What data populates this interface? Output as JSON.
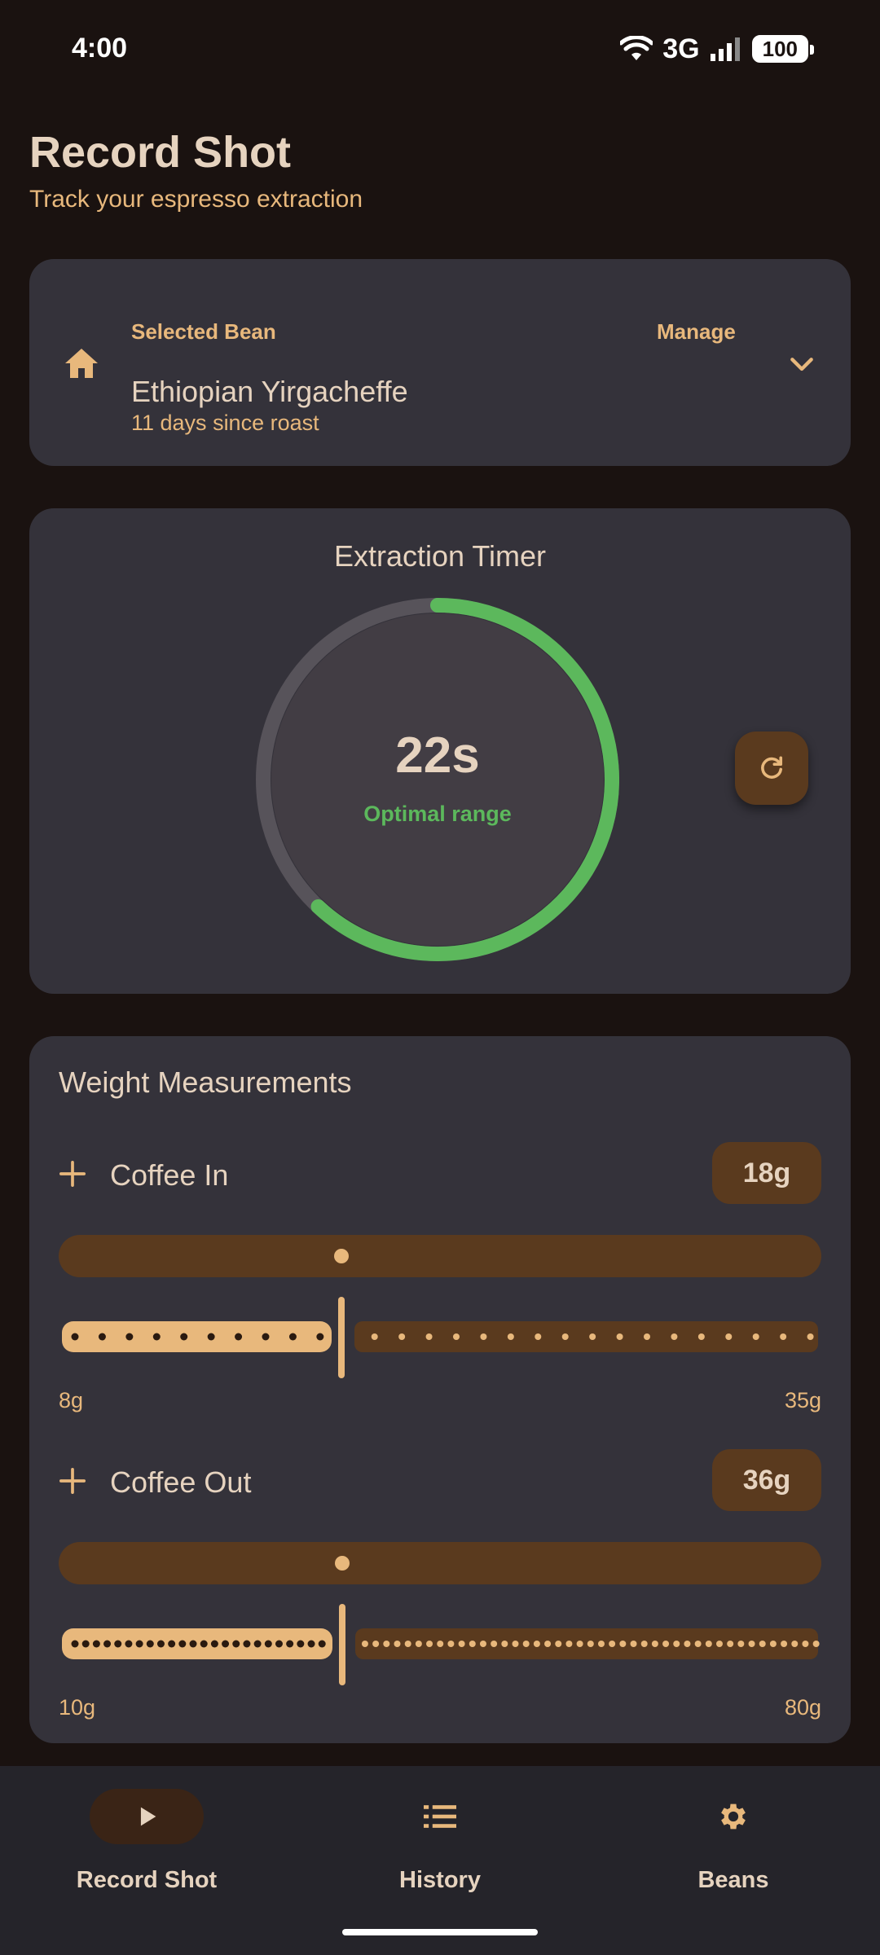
{
  "status_bar": {
    "time": "4:00",
    "network": "3G",
    "battery": "100"
  },
  "header": {
    "title": "Record Shot",
    "subtitle": "Track your espresso extraction"
  },
  "bean": {
    "section_label": "Selected Bean",
    "manage_label": "Manage",
    "name": "Ethiopian Yirgacheffe",
    "roast_info": "11 days since roast",
    "icon": "home-icon"
  },
  "timer": {
    "title": "Extraction Timer",
    "value": "22s",
    "status": "Optimal range",
    "progress_fraction": 0.62,
    "status_color": "#5cb85c",
    "reset_icon": "refresh-icon"
  },
  "weights": {
    "title": "Weight Measurements",
    "coffee_in": {
      "label": "Coffee In",
      "value": "18g",
      "min": "8g",
      "max": "35g",
      "min_value": 8,
      "max_value": 35,
      "current": 18
    },
    "coffee_out": {
      "label": "Coffee Out",
      "value": "36g",
      "min": "10g",
      "max": "80g",
      "min_value": 10,
      "max_value": 80,
      "current": 36
    }
  },
  "nav": {
    "items": [
      {
        "label": "Record Shot",
        "icon": "play-icon",
        "active": true
      },
      {
        "label": "History",
        "icon": "list-icon",
        "active": false
      },
      {
        "label": "Beans",
        "icon": "gear-icon",
        "active": false
      }
    ]
  },
  "colors": {
    "accent": "#e8b87c",
    "brown": "#5a3a1e",
    "card": "#34323a",
    "background": "#1a1210",
    "success": "#5cb85c"
  }
}
